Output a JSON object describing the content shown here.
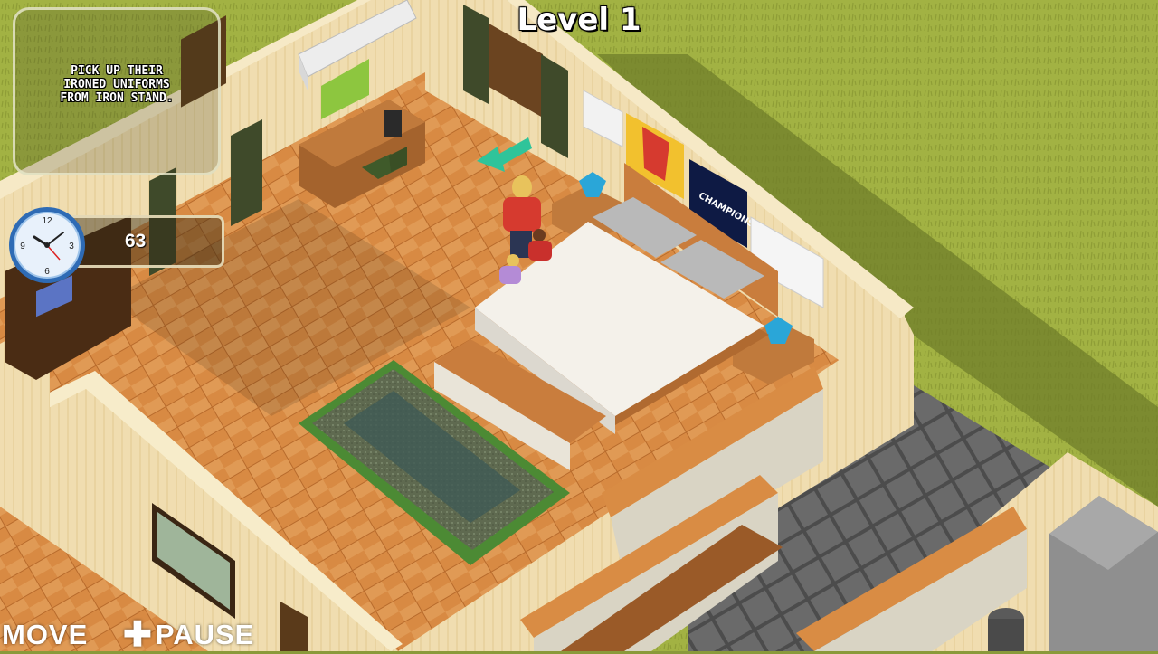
{
  "hud": {
    "level_title": "Level 1",
    "mission_text": "Pick up their\nironed uniforms\nfrom iron stand.",
    "timer_value": "63",
    "move_label": "MOVE",
    "pause_label": "PAUSE",
    "pause_symbol": "✚"
  },
  "scene": {
    "posters": [
      "CHAMPIONS"
    ]
  },
  "colors": {
    "grass": "#9aab3f",
    "floor": "#d98c44",
    "wall": "#f2e2b8",
    "bed_sheet": "#f4f1ea",
    "arrow": "#2fc49a",
    "clock_face": "#4a90d9"
  },
  "icons": {
    "clock": "clock-icon",
    "nav_arrow": "arrow-left-icon",
    "pause": "plus-icon"
  }
}
